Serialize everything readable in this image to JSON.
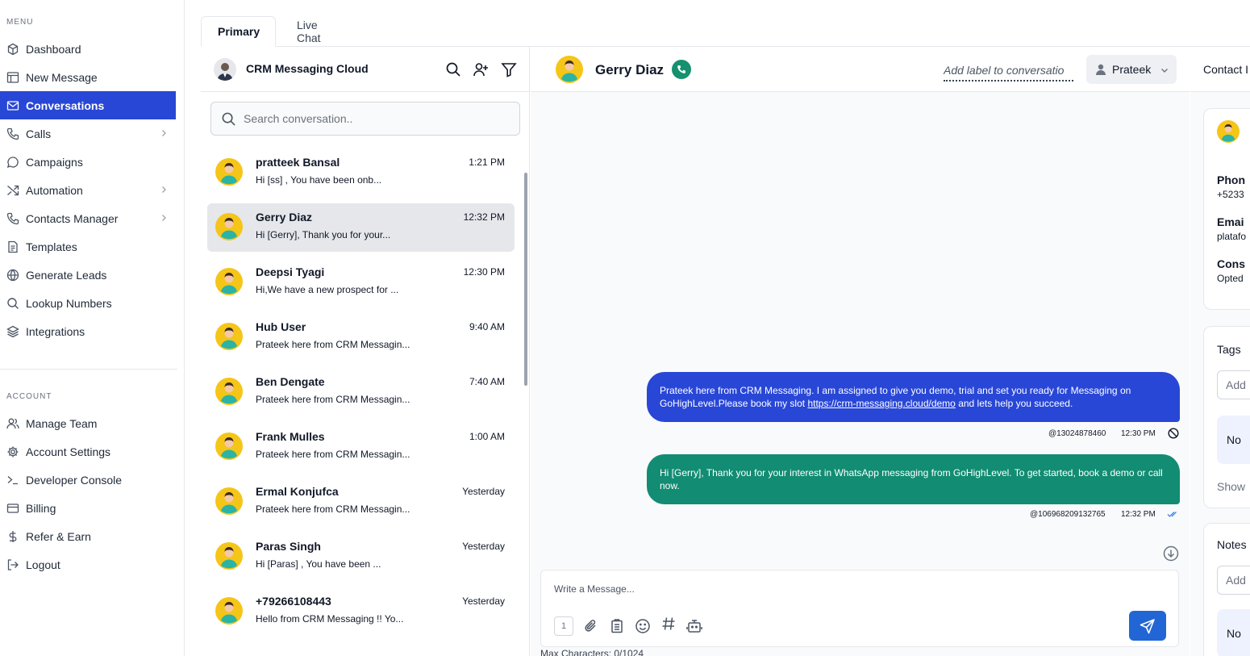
{
  "sidebar": {
    "menu_label": "MENU",
    "account_label": "ACCOUNT",
    "items": [
      {
        "label": "Dashboard",
        "icon": "cube-icon"
      },
      {
        "label": "New Message",
        "icon": "layout-icon"
      },
      {
        "label": "Conversations",
        "icon": "mail-icon",
        "active": true
      },
      {
        "label": "Calls",
        "icon": "phone-icon",
        "has_submenu": true
      },
      {
        "label": "Campaigns",
        "icon": "chat-bubble-icon"
      },
      {
        "label": "Automation",
        "icon": "shuffle-icon",
        "has_submenu": true
      },
      {
        "label": "Contacts Manager",
        "icon": "phone-icon",
        "has_submenu": true
      },
      {
        "label": "Templates",
        "icon": "document-icon"
      },
      {
        "label": "Generate Leads",
        "icon": "globe-icon"
      },
      {
        "label": "Lookup Numbers",
        "icon": "search-icon"
      },
      {
        "label": "Integrations",
        "icon": "layers-icon"
      }
    ],
    "account_items": [
      {
        "label": "Manage Team",
        "icon": "users-icon"
      },
      {
        "label": "Account Settings",
        "icon": "gear-icon"
      },
      {
        "label": "Developer Console",
        "icon": "terminal-icon"
      },
      {
        "label": "Billing",
        "icon": "credit-card-icon"
      },
      {
        "label": "Refer & Earn",
        "icon": "dollar-icon"
      },
      {
        "label": "Logout",
        "icon": "logout-icon"
      }
    ]
  },
  "tabs": [
    {
      "label": "Primary",
      "active": true
    },
    {
      "label": "Live Chat",
      "active": false
    }
  ],
  "conversation_list": {
    "title": "CRM Messaging Cloud",
    "search_placeholder": "Search conversation..",
    "items": [
      {
        "name": "pratteek Bansal",
        "preview": "Hi [ss] , You have been onb...",
        "time": "1:21 PM"
      },
      {
        "name": "Gerry Diaz",
        "preview": "Hi [Gerry], Thank you for your...",
        "time": "12:32 PM",
        "selected": true
      },
      {
        "name": "Deepsi Tyagi",
        "preview": "Hi,We have a new prospect for ...",
        "time": "12:30 PM"
      },
      {
        "name": "Hub User",
        "preview": "Prateek here from CRM Messagin...",
        "time": "9:40 AM"
      },
      {
        "name": "Ben Dengate",
        "preview": "Prateek here from CRM Messagin...",
        "time": "7:40 AM"
      },
      {
        "name": "Frank Mulles",
        "preview": "Prateek here from CRM Messagin...",
        "time": "1:00 AM"
      },
      {
        "name": "Ermal Konjufca",
        "preview": "Prateek here from CRM Messagin...",
        "time": "Yesterday"
      },
      {
        "name": "Paras Singh",
        "preview": "Hi [Paras] , You have been ...",
        "time": "Yesterday"
      },
      {
        "name": "+79266108443",
        "preview": "Hello from CRM Messaging !! Yo...",
        "time": "Yesterday"
      }
    ]
  },
  "chat": {
    "contact_name": "Gerry Diaz",
    "label_placeholder": "Add label to conversatio",
    "assignee": "Prateek",
    "messages": [
      {
        "text_before": "Prateek here from CRM Messaging. I am assigned to give you demo, trial and set you ready for Messaging on GoHighLevel.Please book my slot ",
        "link": "https://crm-messaging.cloud/demo",
        "text_after": " and lets help you succeed.",
        "sender": "@13024878460",
        "time": "12:30 PM",
        "status_icon": "blocked-icon",
        "color": "#2947d6"
      },
      {
        "text": "Hi [Gerry], Thank you for your interest in WhatsApp messaging from GoHighLevel. To get started, book a demo or call now.",
        "sender": "@106968209132765",
        "time": "12:32 PM",
        "status_icon": "double-check-icon",
        "color": "#128c72"
      }
    ],
    "composer_placeholder": "Write a Message...",
    "segment_count": "1",
    "max_characters": "Max Characters: 0/1024"
  },
  "contact_panel": {
    "title": "Contact I",
    "phone_label": "Phon",
    "phone_value": "+5233",
    "email_label": "Emai",
    "email_value": "platafo",
    "consent_label": "Cons",
    "consent_value": "Opted",
    "tags_title": "Tags",
    "tags_input": "Add",
    "tags_empty": "No",
    "show_link": "Show",
    "notes_title": "Notes",
    "notes_input": "Add",
    "notes_empty": "No"
  },
  "colors": {
    "accent": "#2947d6",
    "green": "#128c72",
    "avatar_yellow": "#f5c518"
  }
}
